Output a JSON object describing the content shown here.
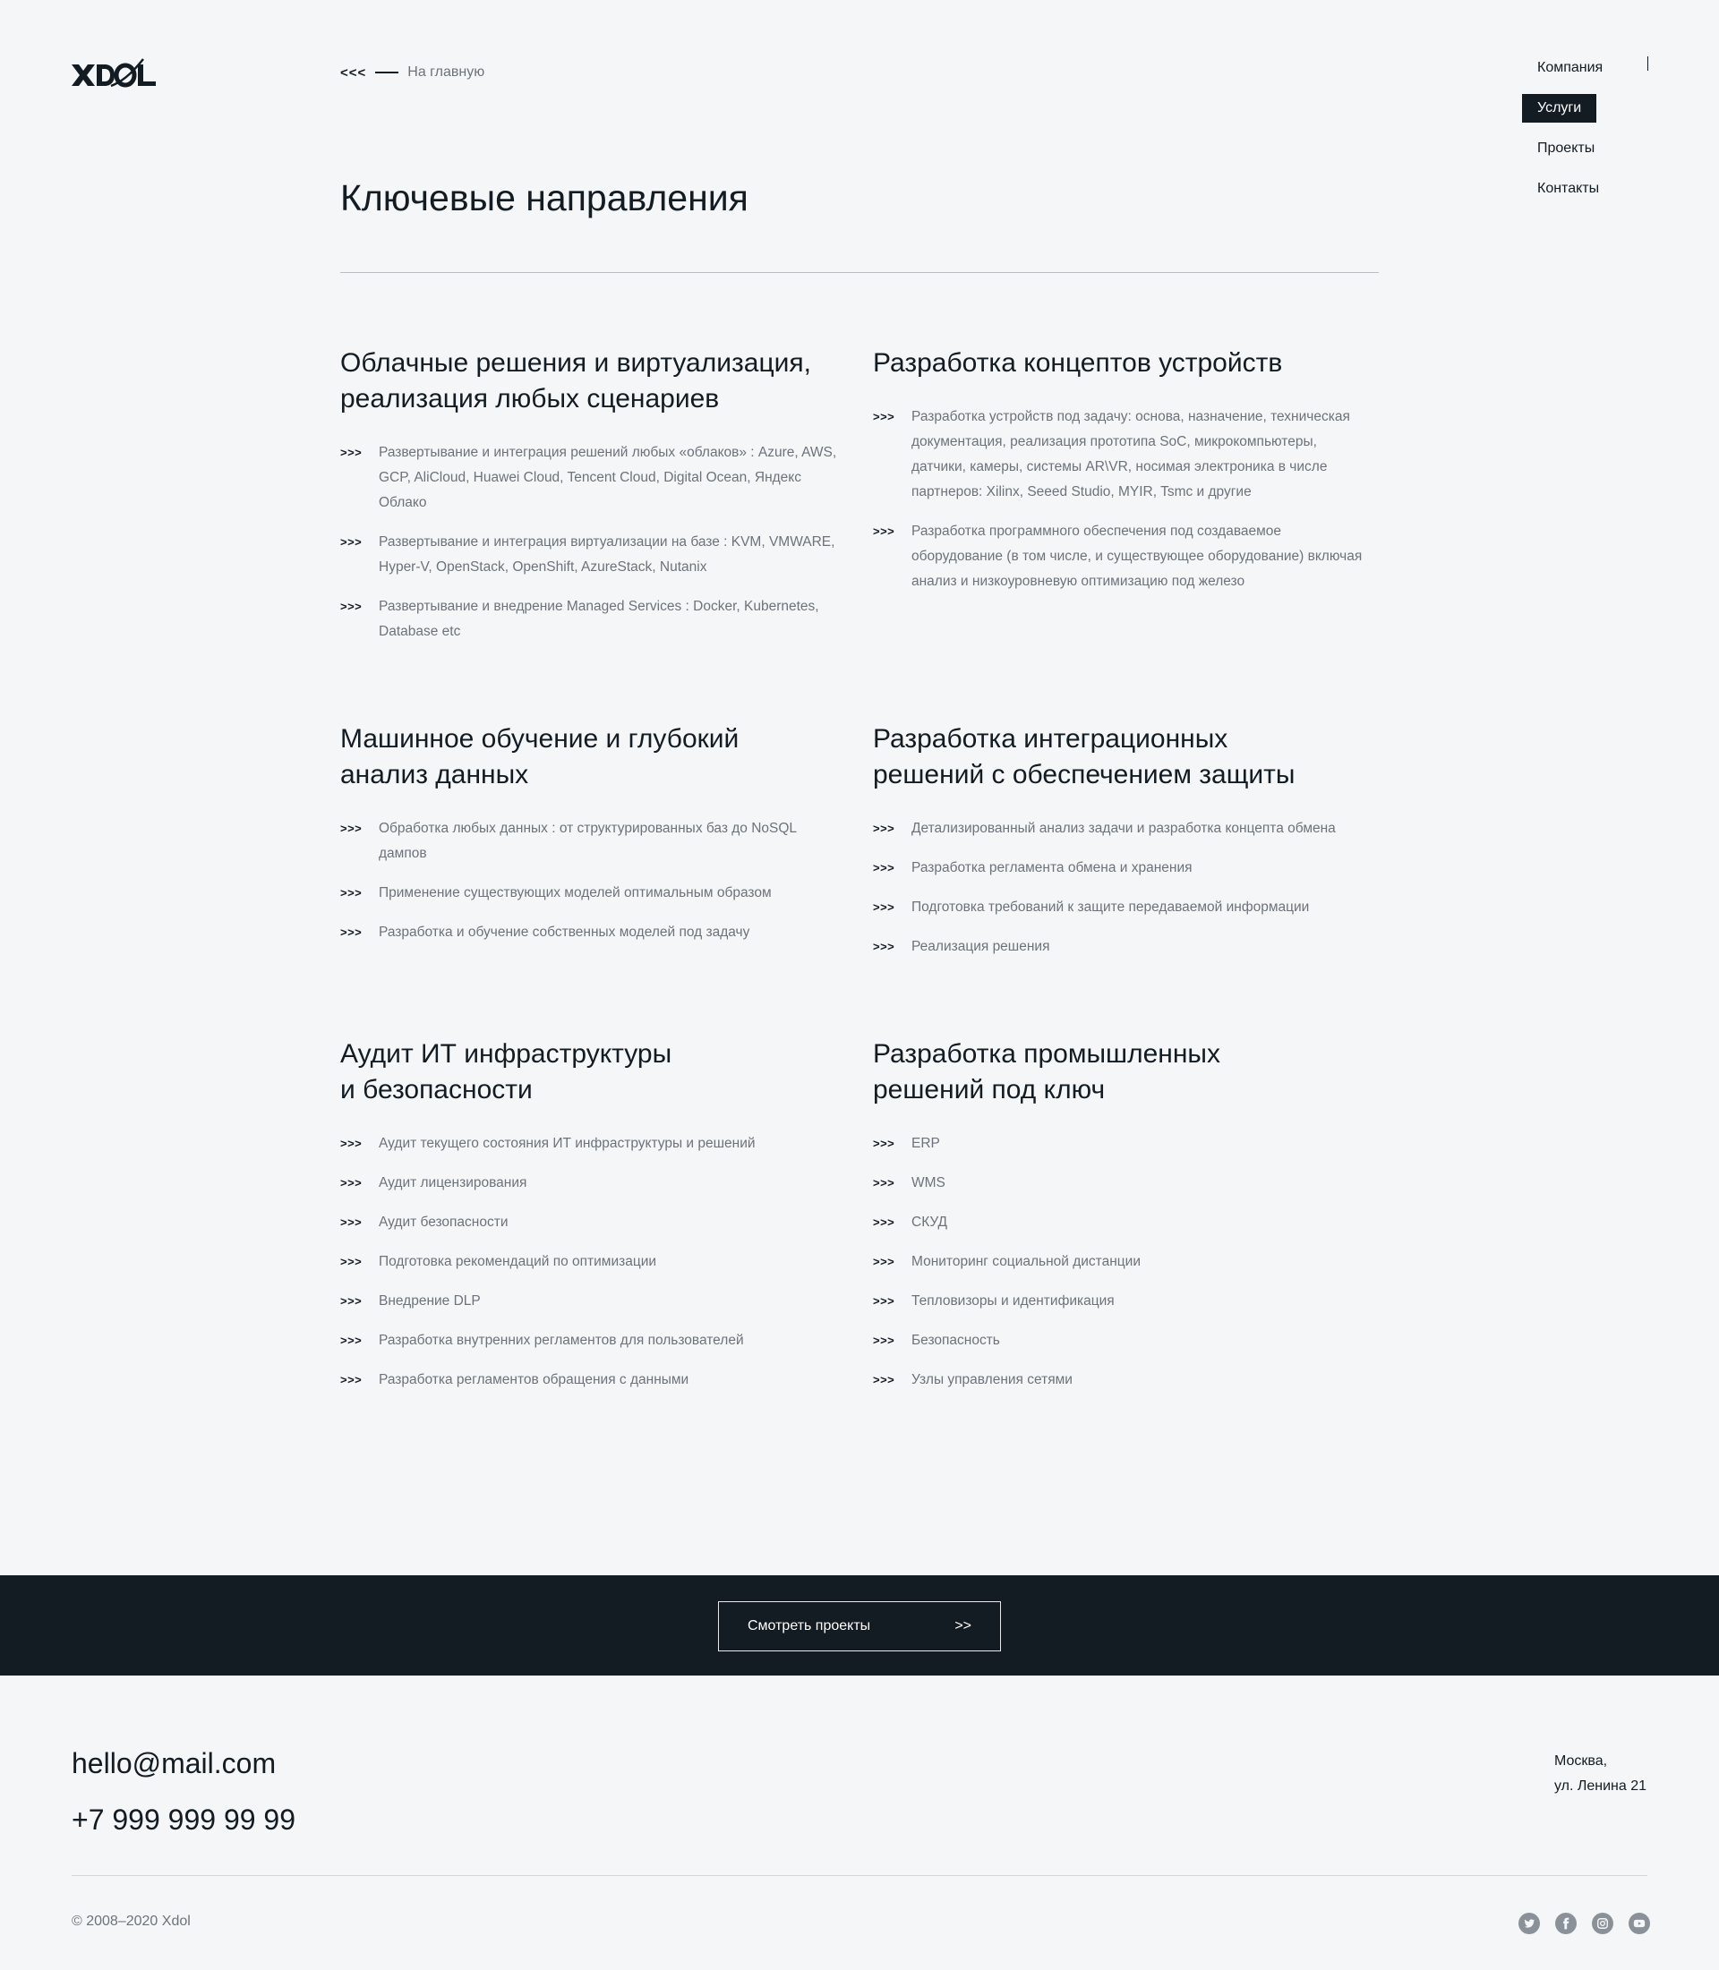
{
  "header": {
    "logo_text": "XDOL",
    "back": {
      "arrows": "<<<",
      "label": "На главную"
    }
  },
  "nav": {
    "items": [
      {
        "label": "Компания",
        "active": false
      },
      {
        "label": "Услуги",
        "active": true
      },
      {
        "label": "Проекты",
        "active": false
      },
      {
        "label": "Контакты",
        "active": false
      }
    ]
  },
  "page": {
    "title": "Ключевые направления"
  },
  "services": [
    {
      "title": "Облачные решения и виртуализация,\nреализация любых сценариев",
      "items": [
        "Развертывание и интеграция решений любых «облаков» : Azure, AWS, GCP, AliCloud, Huawei Cloud, Tencent Cloud, Digital Ocean, Яндекс Облако",
        "Развертывание и интеграция виртуализации на базе : KVM, VMWARE, Hyper-V, OpenStack, OpenShift, AzureStack, Nutanix",
        "Развертывание и внедрение Managed Services : Docker, Kubernetes, Database etc"
      ]
    },
    {
      "title": "Разработка концептов устройств",
      "items": [
        "Разработка устройств под задачу: основа, назначение, техническая документация, реализация прототипа SoC, микрокомпьютеры, датчики, камеры, системы AR\\VR, носимая электроника в числе партнеров: Xilinx, Seeed Studio, MYIR, Tsmc и другие",
        "Разработка программного обеспечения под создаваемое оборудование (в том числе, и существующее оборудование) включая анализ и низкоуровневую оптимизацию под железо"
      ]
    },
    {
      "title": "Машинное обучение и глубокий\nанализ данных",
      "items": [
        "Обработка любых данных : от структурированных баз до NoSQL дампов",
        "Применение существующих моделей оптимальным образом",
        "Разработка и обучение собственных моделей под задачу"
      ]
    },
    {
      "title": "Разработка интеграционных\nрешений с обеспечением защиты",
      "items": [
        "Детализированный анализ задачи и разработка концепта обмена",
        "Разработка регламента обмена и хранения",
        "Подготовка требований к защите передаваемой информации",
        "Реализация решения"
      ]
    },
    {
      "title": "Аудит ИТ инфраструктуры\nи безопасности",
      "items": [
        "Аудит текущего состояния ИТ инфраструктуры и решений",
        "Аудит лицензирования",
        "Аудит безопасности",
        "Подготовка рекомендаций по оптимизации",
        "Внедрение DLP",
        "Разработка внутренних регламентов для пользователей",
        "Разработка регламентов обращения с данными"
      ]
    },
    {
      "title": "Разработка промышленных\nрешений под ключ",
      "items": [
        "ERP",
        "WMS",
        "СКУД",
        "Мониторинг социальной дистанции",
        "Тепловизоры и идентификация",
        "Безопасность",
        "Узлы управления сетями"
      ]
    }
  ],
  "list_marker": ">>>",
  "cta": {
    "label": "Смотреть проекты",
    "arrow": ">>"
  },
  "footer": {
    "email": "hello@mail.com",
    "phone": "+7 999 999 99 99",
    "address_line1": "Москва,",
    "address_line2": "ул. Ленина 21",
    "copyright": "© 2008–2020 Xdol",
    "socials": [
      "twitter-icon",
      "facebook-icon",
      "instagram-icon",
      "youtube-icon"
    ]
  }
}
